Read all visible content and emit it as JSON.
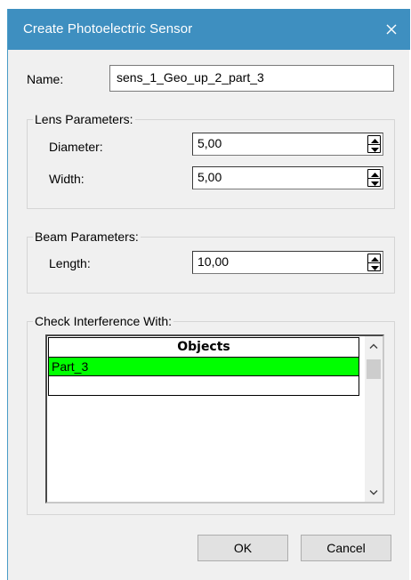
{
  "window": {
    "title": "Create Photoelectric Sensor",
    "close_icon": "close-icon"
  },
  "name_field": {
    "label": "Name:",
    "value": "sens_1_Geo_up_2_part_3"
  },
  "lens_parameters": {
    "title": "Lens Parameters:",
    "diameter_label": "Diameter:",
    "diameter_value": "5,00",
    "width_label": "Width:",
    "width_value": "5,00"
  },
  "beam_parameters": {
    "title": "Beam Parameters:",
    "length_label": "Length:",
    "length_value": "10,00"
  },
  "interference": {
    "title": "Check Interference With:",
    "column_header": "Objects",
    "rows": [
      "Part_3",
      ""
    ],
    "selected_color": "#00ff00"
  },
  "buttons": {
    "ok": "OK",
    "cancel": "Cancel"
  }
}
